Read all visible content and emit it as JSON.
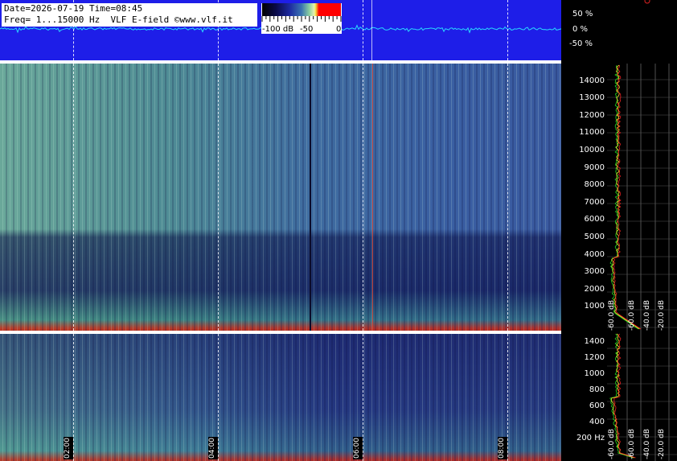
{
  "header": {
    "line1": "Date=2026-07-19 Time=08:45",
    "line2": "Freq= 1...15000 Hz  VLF E-field ©www.vlf.it"
  },
  "colorbar": {
    "labels": [
      "-100 dB",
      "-50",
      "0"
    ]
  },
  "waveform_scale": [
    "50 %",
    "0 %",
    "-50 %"
  ],
  "chart_data": {
    "type": "heatmap",
    "title": "",
    "upper_panel": {
      "ylim": [
        0,
        15000
      ],
      "y_ticks": [
        "14000",
        "13000",
        "12000",
        "11000",
        "10000",
        "9000",
        "8000",
        "7000",
        "6000",
        "5000",
        "4000",
        "3000",
        "2000",
        "1000"
      ]
    },
    "lower_panel": {
      "ylim": [
        0,
        1500
      ],
      "y_ticks": [
        "1400",
        "1200",
        "1000",
        "800",
        "600",
        "400",
        "200 Hz"
      ]
    },
    "x_ticks": [
      "02:00",
      "04:00",
      "06:00",
      "08:00"
    ],
    "spectrum_db_labels": [
      "-60.0 dB",
      "-40.0 dB",
      "-20.0 dB"
    ],
    "colorscale_db": [
      -100,
      0
    ]
  },
  "colors": {
    "waveform_bg": "#1e1ee8",
    "trace": "#29d9ff",
    "spectrum_green": "#22dd22",
    "spectrum_red": "#ee2222",
    "spectrum_yellow": "#f0e030"
  }
}
